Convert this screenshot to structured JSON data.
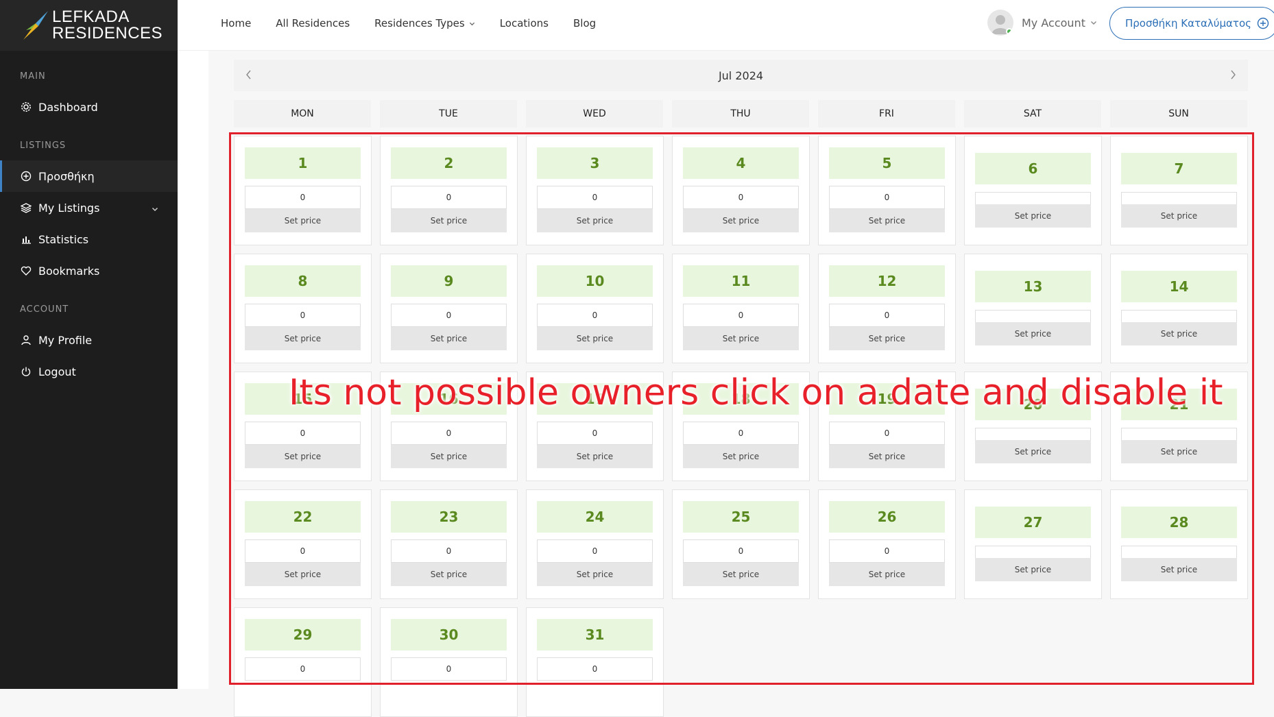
{
  "logo": {
    "line1": "LEFKADA",
    "line2": "RESIDENCES"
  },
  "sidebar": {
    "sections": [
      {
        "title": "MAIN",
        "items": [
          {
            "label": "Dashboard",
            "icon": "gear-icon"
          }
        ]
      },
      {
        "title": "LISTINGS",
        "items": [
          {
            "label": "Προσθήκη",
            "icon": "plus-circle-icon",
            "active": true
          },
          {
            "label": "My Listings",
            "icon": "layers-icon",
            "expandable": true
          },
          {
            "label": "Statistics",
            "icon": "bar-chart-icon"
          },
          {
            "label": "Bookmarks",
            "icon": "heart-icon"
          }
        ]
      },
      {
        "title": "ACCOUNT",
        "items": [
          {
            "label": "My Profile",
            "icon": "user-icon"
          },
          {
            "label": "Logout",
            "icon": "power-icon"
          }
        ]
      }
    ]
  },
  "nav": {
    "home": "Home",
    "all_residences": "All Residences",
    "types": "Residences Types",
    "locations": "Locations",
    "blog": "Blog"
  },
  "account": {
    "label": "My Account"
  },
  "add_button": {
    "label": "Προσθήκη Καταλύματος"
  },
  "calendar": {
    "month": "Jul 2024",
    "weekdays": [
      "MON",
      "TUE",
      "WED",
      "THU",
      "FRI",
      "SAT",
      "SUN"
    ],
    "set_price_label": "Set price",
    "price_value": "0",
    "days": [
      "1",
      "2",
      "3",
      "4",
      "5",
      "6",
      "7",
      "8",
      "9",
      "10",
      "11",
      "12",
      "13",
      "14",
      "15",
      "16",
      "17",
      "18",
      "19",
      "20",
      "21",
      "22",
      "23",
      "24",
      "25",
      "26",
      "27",
      "28",
      "29",
      "30",
      "31"
    ]
  },
  "annotation": {
    "text": "Its not possible owners click on a date and disable it",
    "color": "#e8202a"
  },
  "colors": {
    "accent": "#2c6fb7",
    "day_bg": "#e9f6de",
    "day_text": "#5a8a1f",
    "sidebar_bg": "#1d1d1d"
  }
}
